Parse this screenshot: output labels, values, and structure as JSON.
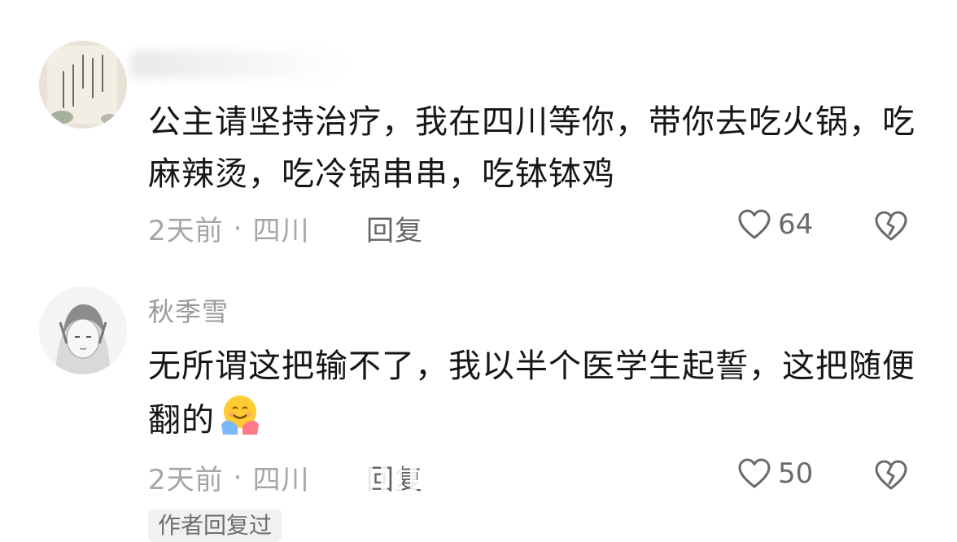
{
  "comments": [
    {
      "username": "",
      "content": "公主请坚持治疗，我在四川等你，带你去吃火锅，吃麻辣烫，吃冷锅串串，吃钵钵鸡",
      "time": "2天前",
      "location": "四川",
      "reply_label": "回复",
      "likes": "64"
    },
    {
      "username": "秋季雪",
      "content": "无所谓这把输不了，我以半个医学生起誓，这把随便翻的",
      "time": "2天前",
      "location": "四川",
      "reply_label": "回复",
      "likes": "50",
      "author_badge": "作者回复过"
    }
  ],
  "separator": "·",
  "icons": {
    "like": "heart-outline-icon",
    "dislike": "broken-heart-icon",
    "emoji": "hugging-face-emoji"
  },
  "colors": {
    "text_primary": "#161616",
    "text_secondary": "#a6a6a6",
    "reply": "#666666"
  }
}
